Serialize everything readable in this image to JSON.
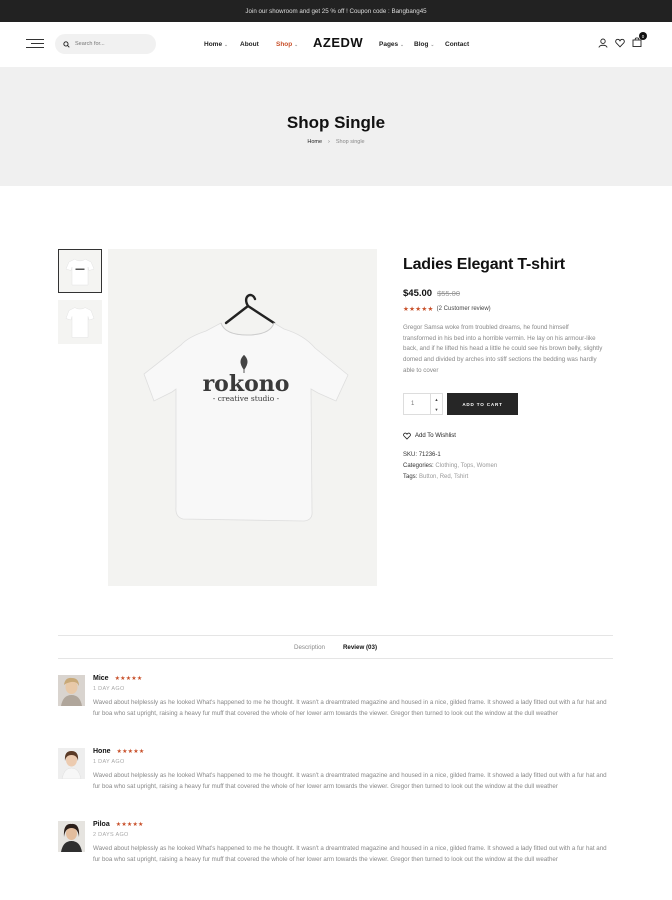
{
  "announcement": "Join our showroom and get 25 % off ! Coupon code : Bangbang45",
  "search": {
    "placeholder": "Search for..."
  },
  "nav": {
    "home": "Home",
    "about": "About",
    "shop": "Shop",
    "logo": "AZEDW",
    "pages": "Pages",
    "blog": "Blog",
    "contact": "Contact"
  },
  "cart_count": "0",
  "page_header": {
    "title": "Shop Single",
    "breadcrumb_home": "Home",
    "breadcrumb_separator": "›",
    "breadcrumb_current": "Shop single"
  },
  "product": {
    "title": "Ladies Elegant T-shirt",
    "price": "$45.00",
    "old_price": "$55.00",
    "stars": "★★★★★",
    "rating_value": 4.5,
    "review_count_label": "(2 Customer review)",
    "description": "Gregor Samsa woke from troubled dreams, he found himself transformed in his bed into a horrible vermin. He lay on his armour-like back, and if he lifted his head a little he could see his brown belly, slightly domed and divided by arches into stiff sections the bedding was hardly able to cover",
    "quantity": "1",
    "add_to_cart": "ADD TO CART",
    "wishlist": "Add To Wishlist",
    "shirt_logo": "rokono",
    "shirt_tagline": "- creative studio -",
    "sku_label": "SKU:",
    "sku": "71236-1",
    "categories_label": "Categories:",
    "categories": [
      "Clothing",
      "Tops",
      "Women"
    ],
    "tags_label": "Tags:",
    "tags": [
      "Button",
      "Red",
      "Tshirt"
    ]
  },
  "tabs": [
    "Description",
    "Review (03)"
  ],
  "reviews": [
    {
      "name": "Mice",
      "stars": "★★★★★",
      "date": "1 DAY AGO",
      "text": "Waved about helplessly as he looked What's happened to me he thought. It wasn't a dreamtrated magazine and housed in a nice, gilded frame. It showed a lady fitted out with a fur hat and fur boa who sat upright, raising a heavy fur muff that covered the whole of her lower arm towards the viewer. Gregor then turned to look out the window at the dull weather"
    },
    {
      "name": "Hone",
      "stars": "★★★★★",
      "date": "1 DAY AGO",
      "text": "Waved about helplessly as he looked What's happened to me he thought. It wasn't a dreamtrated magazine and housed in a nice, gilded frame. It showed a lady fitted out with a fur hat and fur boa who sat upright, raising a heavy fur muff that covered the whole of her lower arm towards the viewer. Gregor then turned to look out the window at the dull weather"
    },
    {
      "name": "Piloa",
      "stars": "★★★★★",
      "date": "2 DAYS AGO",
      "text": "Waved about helplessly as he looked What's happened to me he thought. It wasn't a dreamtrated magazine and housed in a nice, gilded frame. It showed a lady fitted out with a fur hat and fur boa who sat upright, raising a heavy fur muff that covered the whole of her lower arm towards the viewer. Gregor then turned to look out the window at the dull weather"
    }
  ],
  "colors": {
    "accent": "#c8502a",
    "dark": "#262626",
    "header_bg": "#f0f0f0"
  },
  "icons": [
    "menu-icon",
    "search-icon",
    "user-icon",
    "heart-icon",
    "cart-icon",
    "wishlist-heart-icon"
  ]
}
